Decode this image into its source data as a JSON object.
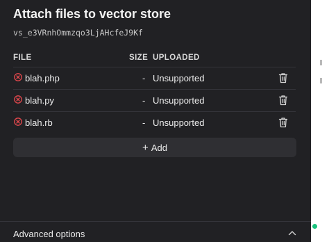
{
  "dialog": {
    "title": "Attach files to vector store",
    "store_id": "vs_e3VRnhOmmzqo3LjAHcfeJ9Kf"
  },
  "table": {
    "headers": {
      "file": "FILE",
      "size": "SIZE",
      "uploaded": "UPLOADED"
    },
    "rows": [
      {
        "name": "blah.php",
        "size": "-",
        "status": "Unsupported"
      },
      {
        "name": "blah.py",
        "size": "-",
        "status": "Unsupported"
      },
      {
        "name": "blah.rb",
        "size": "-",
        "status": "Unsupported"
      }
    ]
  },
  "add_button": {
    "icon": "plus-icon",
    "label": "Add"
  },
  "advanced": {
    "label": "Advanced options",
    "icon": "chevron-up-icon"
  },
  "icons": {
    "row_status": "error-circle-x-icon",
    "row_action": "trash-icon"
  },
  "colors": {
    "panel_background": "#212124",
    "error_red": "#e5484d",
    "button_background": "#2f2f33",
    "status_green": "#19c37d"
  }
}
